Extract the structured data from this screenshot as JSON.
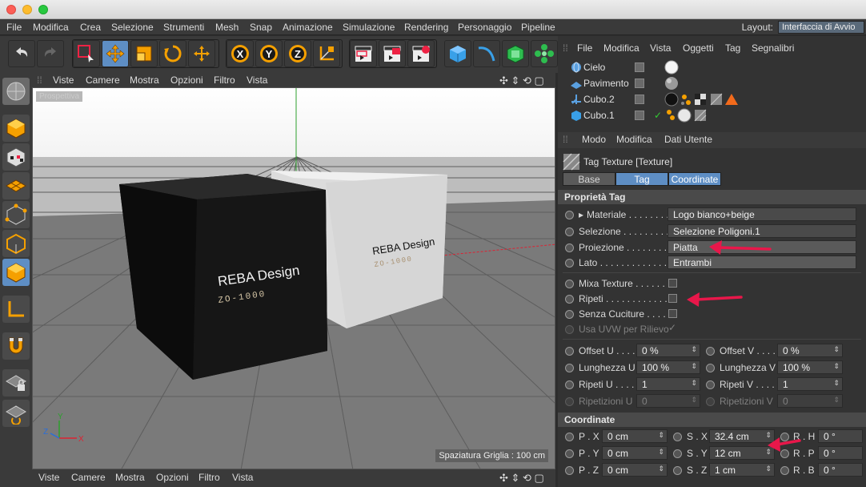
{
  "menubar": {
    "items": [
      "File",
      "Modifica",
      "Crea",
      "Selezione",
      "Strumenti",
      "Mesh",
      "Snap",
      "Animazione",
      "Simulazione",
      "Rendering",
      "Personaggio",
      "Pipeline"
    ],
    "layout_label": "Layout:",
    "layout_value": "Interfaccia di Avvio"
  },
  "viewport": {
    "menu": [
      "Viste",
      "Camere",
      "Mostra",
      "Opzioni",
      "Filtro",
      "Vista"
    ],
    "label": "Prospettiva",
    "grid_spacing": "Spaziatura Griglia : 100 cm",
    "cube_black_text": "REBA Design",
    "cube_black_sub": "ZO-1000",
    "cube_white_text": "REBA Design",
    "cube_white_sub": "ZO-1000",
    "axis_x": "X",
    "axis_y": "Y",
    "axis_z": "Z"
  },
  "bottom_menu": [
    "Viste",
    "Camere",
    "Mostra",
    "Opzioni",
    "Filtro",
    "Vista"
  ],
  "object_manager": {
    "menu": [
      "File",
      "Modifica",
      "Vista",
      "Oggetti",
      "Tag",
      "Segnalibri"
    ],
    "objects": [
      {
        "name": "Cielo"
      },
      {
        "name": "Pavimento"
      },
      {
        "name": "Cubo.2"
      },
      {
        "name": "Cubo.1"
      }
    ]
  },
  "attribute_manager": {
    "menu": [
      "Modo",
      "Modifica",
      "Dati Utente"
    ],
    "title": "Tag Texture [Texture]",
    "tabs": [
      "Base",
      "Tag",
      "Coordinate"
    ],
    "active_tab": "Tag",
    "section_tag": "Proprietà Tag",
    "props": {
      "materiale_label": "Materiale . . . . . . . .",
      "materiale_value": "Logo bianco+beige",
      "selezione_label": "Selezione . . . . . . . . .",
      "selezione_value": "Selezione Poligoni.1",
      "proiezione_label": "Proiezione . . . . . . . . .",
      "proiezione_value": "Piatta",
      "lato_label": "Lato . . . . . . . . . . . . .",
      "lato_value": "Entrambi",
      "mixa_label": "Mixa Texture . . . . . . .",
      "ripeti_label": "Ripeti . . . . . . . . . . . .",
      "senza_label": "Senza Cuciture . . . . .",
      "usa_label": "Usa UVW per Rilievo"
    },
    "uv": {
      "offset_u_label": "Offset U . . . .",
      "offset_u": "0 %",
      "offset_v_label": "Offset V . . . .",
      "offset_v": "0 %",
      "lung_u_label": "Lunghezza U",
      "lung_u": "100 %",
      "lung_v_label": "Lunghezza V",
      "lung_v": "100 %",
      "ripeti_u_label": "Ripeti U . . . .",
      "ripeti_u": "1",
      "ripeti_v_label": "Ripeti V . . . .",
      "ripeti_v": "1",
      "ripetizioni_u_label": "Ripetizioni U",
      "ripetizioni_u": "0",
      "ripetizioni_v_label": "Ripetizioni V",
      "ripetizioni_v": "0"
    },
    "section_coord": "Coordinate",
    "coord": {
      "px_label": "P . X",
      "px": "0 cm",
      "py_label": "P . Y",
      "py": "0 cm",
      "pz_label": "P . Z",
      "pz": "0 cm",
      "sx_label": "S . X",
      "sx": "32.4 cm",
      "sy_label": "S . Y",
      "sy": "12 cm",
      "sz_label": "S . Z",
      "sz": "1 cm",
      "rh_label": "R . H",
      "rh": "0 °",
      "rp_label": "R . P",
      "rp": "0 °",
      "rb_label": "R . B",
      "rb": "0 °"
    }
  },
  "colors": {
    "accent": "#5e8ec4",
    "annotation_arrow": "#e8174a",
    "panel": "#333333"
  }
}
